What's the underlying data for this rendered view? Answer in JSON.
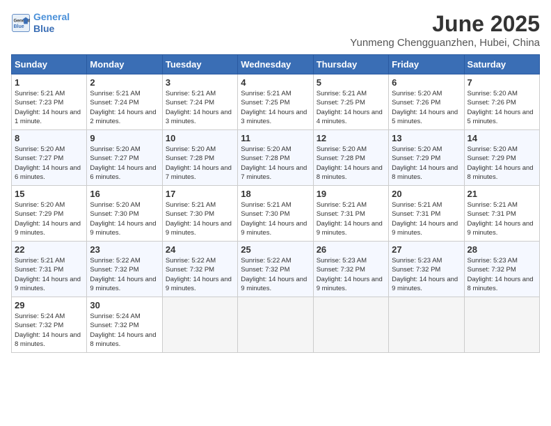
{
  "header": {
    "logo_line1": "General",
    "logo_line2": "Blue",
    "month_year": "June 2025",
    "location": "Yunmeng Chengguanzhen, Hubei, China"
  },
  "weekdays": [
    "Sunday",
    "Monday",
    "Tuesday",
    "Wednesday",
    "Thursday",
    "Friday",
    "Saturday"
  ],
  "weeks": [
    [
      {
        "day": "1",
        "info": "Sunrise: 5:21 AM\nSunset: 7:23 PM\nDaylight: 14 hours and 1 minute."
      },
      {
        "day": "2",
        "info": "Sunrise: 5:21 AM\nSunset: 7:24 PM\nDaylight: 14 hours and 2 minutes."
      },
      {
        "day": "3",
        "info": "Sunrise: 5:21 AM\nSunset: 7:24 PM\nDaylight: 14 hours and 3 minutes."
      },
      {
        "day": "4",
        "info": "Sunrise: 5:21 AM\nSunset: 7:25 PM\nDaylight: 14 hours and 3 minutes."
      },
      {
        "day": "5",
        "info": "Sunrise: 5:21 AM\nSunset: 7:25 PM\nDaylight: 14 hours and 4 minutes."
      },
      {
        "day": "6",
        "info": "Sunrise: 5:20 AM\nSunset: 7:26 PM\nDaylight: 14 hours and 5 minutes."
      },
      {
        "day": "7",
        "info": "Sunrise: 5:20 AM\nSunset: 7:26 PM\nDaylight: 14 hours and 5 minutes."
      }
    ],
    [
      {
        "day": "8",
        "info": "Sunrise: 5:20 AM\nSunset: 7:27 PM\nDaylight: 14 hours and 6 minutes."
      },
      {
        "day": "9",
        "info": "Sunrise: 5:20 AM\nSunset: 7:27 PM\nDaylight: 14 hours and 6 minutes."
      },
      {
        "day": "10",
        "info": "Sunrise: 5:20 AM\nSunset: 7:28 PM\nDaylight: 14 hours and 7 minutes."
      },
      {
        "day": "11",
        "info": "Sunrise: 5:20 AM\nSunset: 7:28 PM\nDaylight: 14 hours and 7 minutes."
      },
      {
        "day": "12",
        "info": "Sunrise: 5:20 AM\nSunset: 7:28 PM\nDaylight: 14 hours and 8 minutes."
      },
      {
        "day": "13",
        "info": "Sunrise: 5:20 AM\nSunset: 7:29 PM\nDaylight: 14 hours and 8 minutes."
      },
      {
        "day": "14",
        "info": "Sunrise: 5:20 AM\nSunset: 7:29 PM\nDaylight: 14 hours and 8 minutes."
      }
    ],
    [
      {
        "day": "15",
        "info": "Sunrise: 5:20 AM\nSunset: 7:29 PM\nDaylight: 14 hours and 9 minutes."
      },
      {
        "day": "16",
        "info": "Sunrise: 5:20 AM\nSunset: 7:30 PM\nDaylight: 14 hours and 9 minutes."
      },
      {
        "day": "17",
        "info": "Sunrise: 5:21 AM\nSunset: 7:30 PM\nDaylight: 14 hours and 9 minutes."
      },
      {
        "day": "18",
        "info": "Sunrise: 5:21 AM\nSunset: 7:30 PM\nDaylight: 14 hours and 9 minutes."
      },
      {
        "day": "19",
        "info": "Sunrise: 5:21 AM\nSunset: 7:31 PM\nDaylight: 14 hours and 9 minutes."
      },
      {
        "day": "20",
        "info": "Sunrise: 5:21 AM\nSunset: 7:31 PM\nDaylight: 14 hours and 9 minutes."
      },
      {
        "day": "21",
        "info": "Sunrise: 5:21 AM\nSunset: 7:31 PM\nDaylight: 14 hours and 9 minutes."
      }
    ],
    [
      {
        "day": "22",
        "info": "Sunrise: 5:21 AM\nSunset: 7:31 PM\nDaylight: 14 hours and 9 minutes."
      },
      {
        "day": "23",
        "info": "Sunrise: 5:22 AM\nSunset: 7:32 PM\nDaylight: 14 hours and 9 minutes."
      },
      {
        "day": "24",
        "info": "Sunrise: 5:22 AM\nSunset: 7:32 PM\nDaylight: 14 hours and 9 minutes."
      },
      {
        "day": "25",
        "info": "Sunrise: 5:22 AM\nSunset: 7:32 PM\nDaylight: 14 hours and 9 minutes."
      },
      {
        "day": "26",
        "info": "Sunrise: 5:23 AM\nSunset: 7:32 PM\nDaylight: 14 hours and 9 minutes."
      },
      {
        "day": "27",
        "info": "Sunrise: 5:23 AM\nSunset: 7:32 PM\nDaylight: 14 hours and 9 minutes."
      },
      {
        "day": "28",
        "info": "Sunrise: 5:23 AM\nSunset: 7:32 PM\nDaylight: 14 hours and 8 minutes."
      }
    ],
    [
      {
        "day": "29",
        "info": "Sunrise: 5:24 AM\nSunset: 7:32 PM\nDaylight: 14 hours and 8 minutes."
      },
      {
        "day": "30",
        "info": "Sunrise: 5:24 AM\nSunset: 7:32 PM\nDaylight: 14 hours and 8 minutes."
      },
      {
        "day": "",
        "info": ""
      },
      {
        "day": "",
        "info": ""
      },
      {
        "day": "",
        "info": ""
      },
      {
        "day": "",
        "info": ""
      },
      {
        "day": "",
        "info": ""
      }
    ]
  ]
}
